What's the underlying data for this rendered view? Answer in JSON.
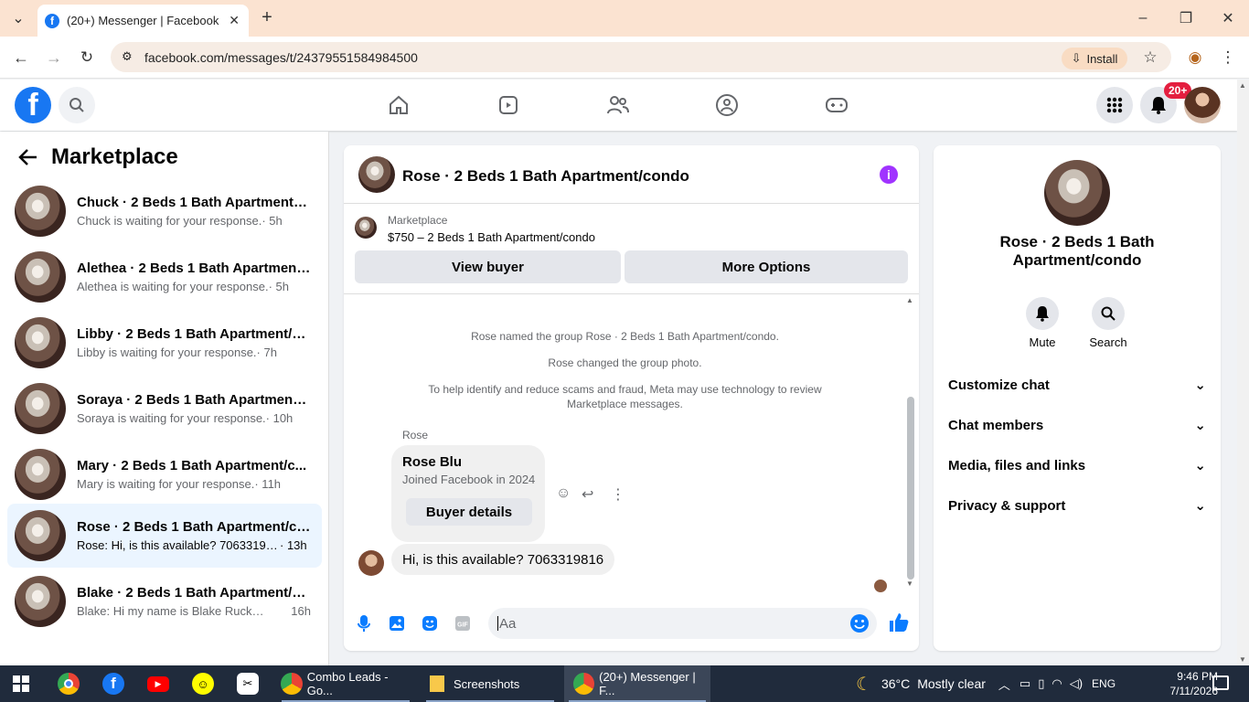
{
  "browser": {
    "tab_title": "(20+) Messenger | Facebook",
    "url": "facebook.com/messages/t/24379551584984500",
    "install_label": "Install"
  },
  "fb": {
    "notification_badge": "20+"
  },
  "sidebar": {
    "title": "Marketplace",
    "conversations": [
      {
        "name": "Chuck · 2 Beds 1 Bath Apartment/c...",
        "preview": "Chuck is waiting for your response.",
        "time": "· 5h"
      },
      {
        "name": "Alethea · 2 Beds 1 Bath Apartment...",
        "preview": "Alethea is waiting for your response.",
        "time": "· 5h"
      },
      {
        "name": "Libby · 2 Beds 1 Bath Apartment/c...",
        "preview": "Libby is waiting for your response.",
        "time": "· 7h"
      },
      {
        "name": "Soraya · 2 Beds 1 Bath Apartment/...",
        "preview": "Soraya is waiting for your response.",
        "time": "· 10h"
      },
      {
        "name": "Mary · 2 Beds 1 Bath Apartment/c...",
        "preview": "Mary is waiting for your response.",
        "time": "· 11h"
      },
      {
        "name": "Rose · 2 Beds 1 Bath Apartment/co...",
        "preview": "Rose: Hi, is this available? 7063319816",
        "time": "· 13h"
      },
      {
        "name": "Blake · 2 Beds 1 Bath Apartment/c...",
        "preview": "Blake: Hi my name is Blake Rucker m...",
        "time": "16h"
      }
    ]
  },
  "chat": {
    "title": "Rose · 2 Beds 1 Bath Apartment/condo",
    "marketplace_label": "Marketplace",
    "listing": "$750 – 2 Beds 1 Bath Apartment/condo",
    "view_buyer": "View buyer",
    "more_options": "More Options",
    "system_messages": [
      "Rose named the group Rose · 2 Beds 1 Bath Apartment/condo.",
      "Rose changed the group photo.",
      "To help identify and reduce scams and fraud, Meta may use technology to review Marketplace messages."
    ],
    "sender": "Rose",
    "card": {
      "name": "Rose Blu",
      "joined": "Joined Facebook in 2024",
      "button": "Buyer details"
    },
    "message": "Hi, is this available? 7063319816",
    "input_placeholder": "Aa"
  },
  "info_panel": {
    "name": "Rose · 2 Beds 1 Bath Apartment/condo",
    "mute": "Mute",
    "search": "Search",
    "sections": [
      "Customize chat",
      "Chat members",
      "Media, files and links",
      "Privacy & support"
    ]
  },
  "taskbar": {
    "apps": [
      {
        "label": "Combo Leads - Go..."
      },
      {
        "label": "Screenshots"
      },
      {
        "label": "(20+) Messenger | F..."
      }
    ],
    "weather": "36°C",
    "weather_text": "Mostly clear",
    "lang": "ENG",
    "time": "9:46 PM",
    "date": "7/11/2026"
  }
}
